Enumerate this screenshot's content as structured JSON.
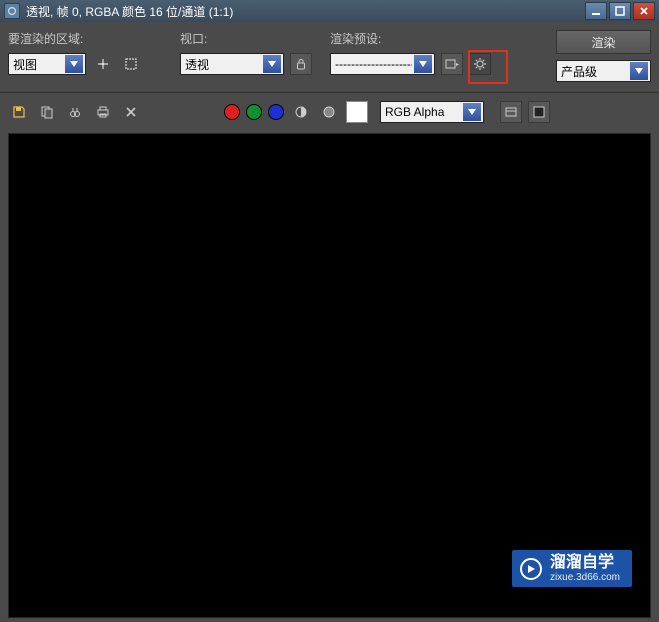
{
  "titlebar": {
    "title": "透视, 帧 0, RGBA 颜色 16 位/通道 (1:1)"
  },
  "render_button": "渲染",
  "labels": {
    "area": "要渲染的区域:",
    "viewport": "视口:",
    "preset": "渲染预设:"
  },
  "dropdowns": {
    "area": "视图",
    "viewport": "透视",
    "preset": "-------------------------",
    "quality": "产品级",
    "channel": "RGB Alpha"
  },
  "watermark": {
    "main": "溜溜自学",
    "sub": "zixue.3d66.com"
  }
}
